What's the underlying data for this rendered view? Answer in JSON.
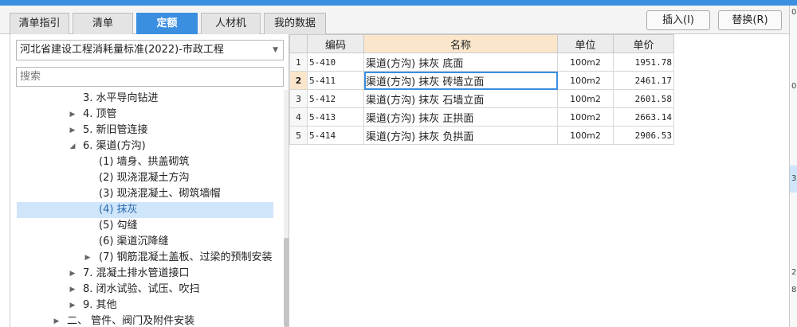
{
  "tabs": [
    {
      "label": "清单指引",
      "active": false
    },
    {
      "label": "清单",
      "active": false
    },
    {
      "label": "定额",
      "active": true
    },
    {
      "label": "人材机",
      "active": false
    },
    {
      "label": "我的数据",
      "active": false
    }
  ],
  "toolbar": {
    "insert_label": "插入(I)",
    "replace_label": "替换(R)"
  },
  "standard": {
    "selected": "河北省建设工程消耗量标准(2022)-市政工程"
  },
  "search": {
    "placeholder": "搜索",
    "value": ""
  },
  "tree": [
    {
      "label": "3. 水平导向钻进",
      "expander": "none",
      "level": 3,
      "selected": false
    },
    {
      "label": "4. 顶管",
      "expander": "collapsed",
      "level": 2,
      "selected": false
    },
    {
      "label": "5. 新旧管连接",
      "expander": "collapsed",
      "level": 2,
      "selected": false
    },
    {
      "label": "6. 渠道(方沟)",
      "expander": "expanded",
      "level": 2,
      "selected": false
    },
    {
      "label": "(1) 墙身、拱盖砌筑",
      "expander": "none",
      "level": 4,
      "selected": false
    },
    {
      "label": "(2) 现浇混凝土方沟",
      "expander": "none",
      "level": 4,
      "selected": false
    },
    {
      "label": "(3) 现浇混凝土、砌筑墙帽",
      "expander": "none",
      "level": 4,
      "selected": false
    },
    {
      "label": "(4) 抹灰",
      "expander": "none",
      "level": 4,
      "selected": true
    },
    {
      "label": "(5) 勾缝",
      "expander": "none",
      "level": 4,
      "selected": false
    },
    {
      "label": "(6) 渠道沉降缝",
      "expander": "none",
      "level": 4,
      "selected": false
    },
    {
      "label": "(7) 钢筋混凝土盖板、过梁的预制安装",
      "expander": "collapsed",
      "level": 3,
      "selected": false
    },
    {
      "label": "7. 混凝土排水管道接口",
      "expander": "collapsed",
      "level": 2,
      "selected": false
    },
    {
      "label": "8. 闭水试验、试压、吹扫",
      "expander": "collapsed",
      "level": 2,
      "selected": false
    },
    {
      "label": "9. 其他",
      "expander": "collapsed",
      "level": 2,
      "selected": false
    },
    {
      "label": "二、 管件、阀门及附件安装",
      "expander": "collapsed",
      "level": 1,
      "selected": false
    }
  ],
  "grid": {
    "columns": {
      "code": "编码",
      "name": "名称",
      "unit": "单位",
      "price": "单价"
    },
    "rows": [
      {
        "no": "1",
        "code": "5-410",
        "name": "渠道(方沟) 抹灰 底面",
        "unit": "100m2",
        "price": "1951.78",
        "current": false
      },
      {
        "no": "2",
        "code": "5-411",
        "name": "渠道(方沟) 抹灰 砖墙立面",
        "unit": "100m2",
        "price": "2461.17",
        "current": true
      },
      {
        "no": "3",
        "code": "5-412",
        "name": "渠道(方沟) 抹灰 石墙立面",
        "unit": "100m2",
        "price": "2601.58",
        "current": false
      },
      {
        "no": "4",
        "code": "5-413",
        "name": "渠道(方沟) 抹灰 正拱面",
        "unit": "100m2",
        "price": "2663.14",
        "current": false
      },
      {
        "no": "5",
        "code": "5-414",
        "name": "渠道(方沟) 抹灰 负拱面",
        "unit": "100m2",
        "price": "2906.53",
        "current": false
      }
    ]
  },
  "edge_values": [
    "0",
    "0",
    "3",
    "2",
    "8"
  ],
  "colors": {
    "accent": "#3b8fe0",
    "selected_bg": "#cfe5f9",
    "header_highlight": "#fbe6cc"
  }
}
